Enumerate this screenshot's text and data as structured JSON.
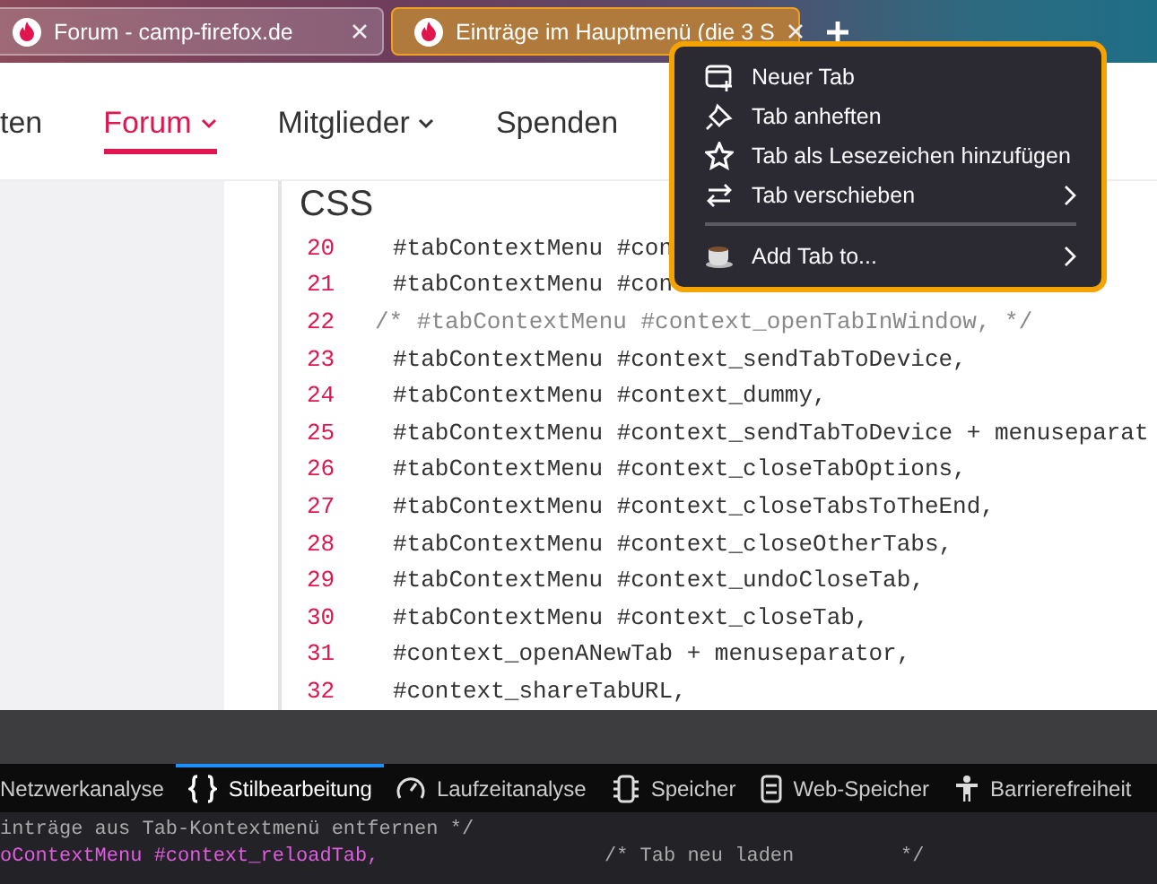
{
  "tabs": [
    {
      "title": "Forum - camp-firefox.de",
      "selected": false
    },
    {
      "title": "Einträge im Hauptmenü (die 3 S",
      "selected": true
    }
  ],
  "nav": [
    {
      "label": "ten",
      "selected": false,
      "dropdown": false
    },
    {
      "label": "Forum",
      "selected": true,
      "dropdown": true
    },
    {
      "label": "Mitglieder",
      "selected": false,
      "dropdown": true
    },
    {
      "label": "Spenden",
      "selected": false,
      "dropdown": false
    }
  ],
  "code_block": {
    "title": "CSS",
    "lines": [
      {
        "number": "20",
        "text": "#tabContextMenu #con",
        "kind": "code"
      },
      {
        "number": "21",
        "text": "#tabContextMenu #con",
        "kind": "code"
      },
      {
        "number": "22",
        "text": "/* #tabContextMenu #context_openTabInWindow, */",
        "kind": "comment"
      },
      {
        "number": "23",
        "text": "#tabContextMenu #context_sendTabToDevice,",
        "kind": "code"
      },
      {
        "number": "24",
        "text": "#tabContextMenu #context_dummy,",
        "kind": "code"
      },
      {
        "number": "25",
        "text": "#tabContextMenu #context_sendTabToDevice + menuseparat",
        "kind": "code"
      },
      {
        "number": "26",
        "text": "#tabContextMenu #context_closeTabOptions,",
        "kind": "code"
      },
      {
        "number": "27",
        "text": "#tabContextMenu #context_closeTabsToTheEnd,",
        "kind": "code"
      },
      {
        "number": "28",
        "text": "#tabContextMenu #context_closeOtherTabs,",
        "kind": "code"
      },
      {
        "number": "29",
        "text": "#tabContextMenu #context_undoCloseTab,",
        "kind": "code"
      },
      {
        "number": "30",
        "text": "#tabContextMenu #context_closeTab,",
        "kind": "code"
      },
      {
        "number": "31",
        "text": "#context_openANewTab + menuseparator,",
        "kind": "code"
      },
      {
        "number": "32",
        "text": "#context_shareTabURL,",
        "kind": "code"
      }
    ]
  },
  "context_menu": {
    "items": [
      {
        "kind": "item",
        "label": "Neuer Tab",
        "submenu": false
      },
      {
        "kind": "item",
        "label": "Tab anheften",
        "submenu": false
      },
      {
        "kind": "item",
        "label": "Tab als Lesezeichen hinzufügen",
        "submenu": false
      },
      {
        "kind": "item",
        "label": "Tab verschieben",
        "submenu": true
      },
      {
        "kind": "separator"
      },
      {
        "kind": "item",
        "label": "Add Tab to...",
        "submenu": true
      }
    ]
  },
  "devtools": {
    "tabs": [
      {
        "label": "Netzwerkanalyse",
        "selected": false
      },
      {
        "label": "Stilbearbeitung",
        "selected": true
      },
      {
        "label": "Laufzeitanalyse",
        "selected": false
      },
      {
        "label": "Speicher",
        "selected": false
      },
      {
        "label": "Web-Speicher",
        "selected": false
      },
      {
        "label": "Barrierefreiheit",
        "selected": false
      }
    ],
    "editor_lines": [
      {
        "text": "inträge aus Tab-Kontextmenü entfernen */"
      },
      {
        "text": "oContextMenu #context_reloadTab,",
        "comment": "/* Tab neu laden         */"
      }
    ]
  }
}
